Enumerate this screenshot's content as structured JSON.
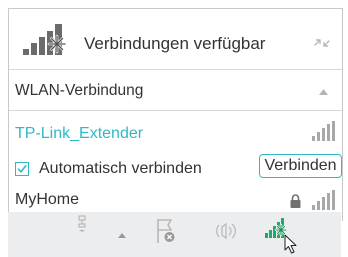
{
  "header": {
    "title": "Verbindungen verfügbar",
    "icon": "network-star-icon",
    "refresh_icon": "refresh-arrows-icon"
  },
  "section": {
    "label": "WLAN-Verbindung",
    "collapse_icon": "chevron-up-icon"
  },
  "networks": [
    {
      "name": "TP-Link_Extender",
      "selected": true,
      "secured": false,
      "signal_bars": 4,
      "auto_connect_label": "Automatisch verbinden",
      "auto_connect_checked": true,
      "connect_label": "Verbinden"
    },
    {
      "name": "MyHome",
      "selected": false,
      "secured": true,
      "signal_bars": 4
    }
  ],
  "taskbar": {
    "icons": [
      "network-cable-icon",
      "show-hidden-arrow-icon",
      "action-center-flag-icon",
      "volume-icon",
      "wifi-network-icon"
    ]
  },
  "colors": {
    "accent": "#2fb9c8",
    "text": "#333333",
    "taskbar_bg": "#ebedee"
  }
}
